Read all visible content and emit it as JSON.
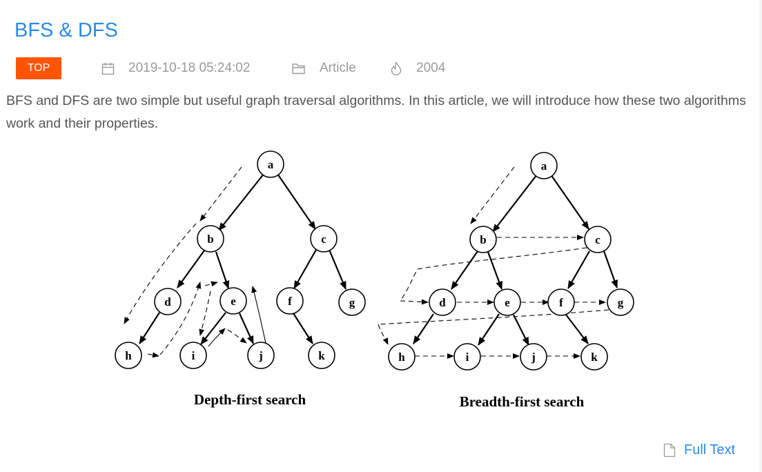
{
  "article": {
    "title": "BFS & DFS",
    "badge": "TOP",
    "date": "2019-10-18 05:24:02",
    "category": "Article",
    "views": "2004",
    "summary": "BFS and DFS are two simple but useful graph traversal algorithms. In this article, we will introduce how these two algorithms work and their properties.",
    "full_text_link": "Full Text"
  },
  "figure": {
    "dfs_caption": "Depth-first search",
    "bfs_caption": "Breadth-first search",
    "nodes": [
      "a",
      "b",
      "c",
      "d",
      "e",
      "f",
      "g",
      "h",
      "i",
      "j",
      "k"
    ]
  },
  "icons": {
    "date": "calendar-icon",
    "category": "folder-icon",
    "views": "flame-icon",
    "full_text": "document-icon"
  },
  "colors": {
    "title": "#2a8be6",
    "badge": "#ff5500",
    "meta_text": "#9a9a9a",
    "body_text": "#555555"
  }
}
